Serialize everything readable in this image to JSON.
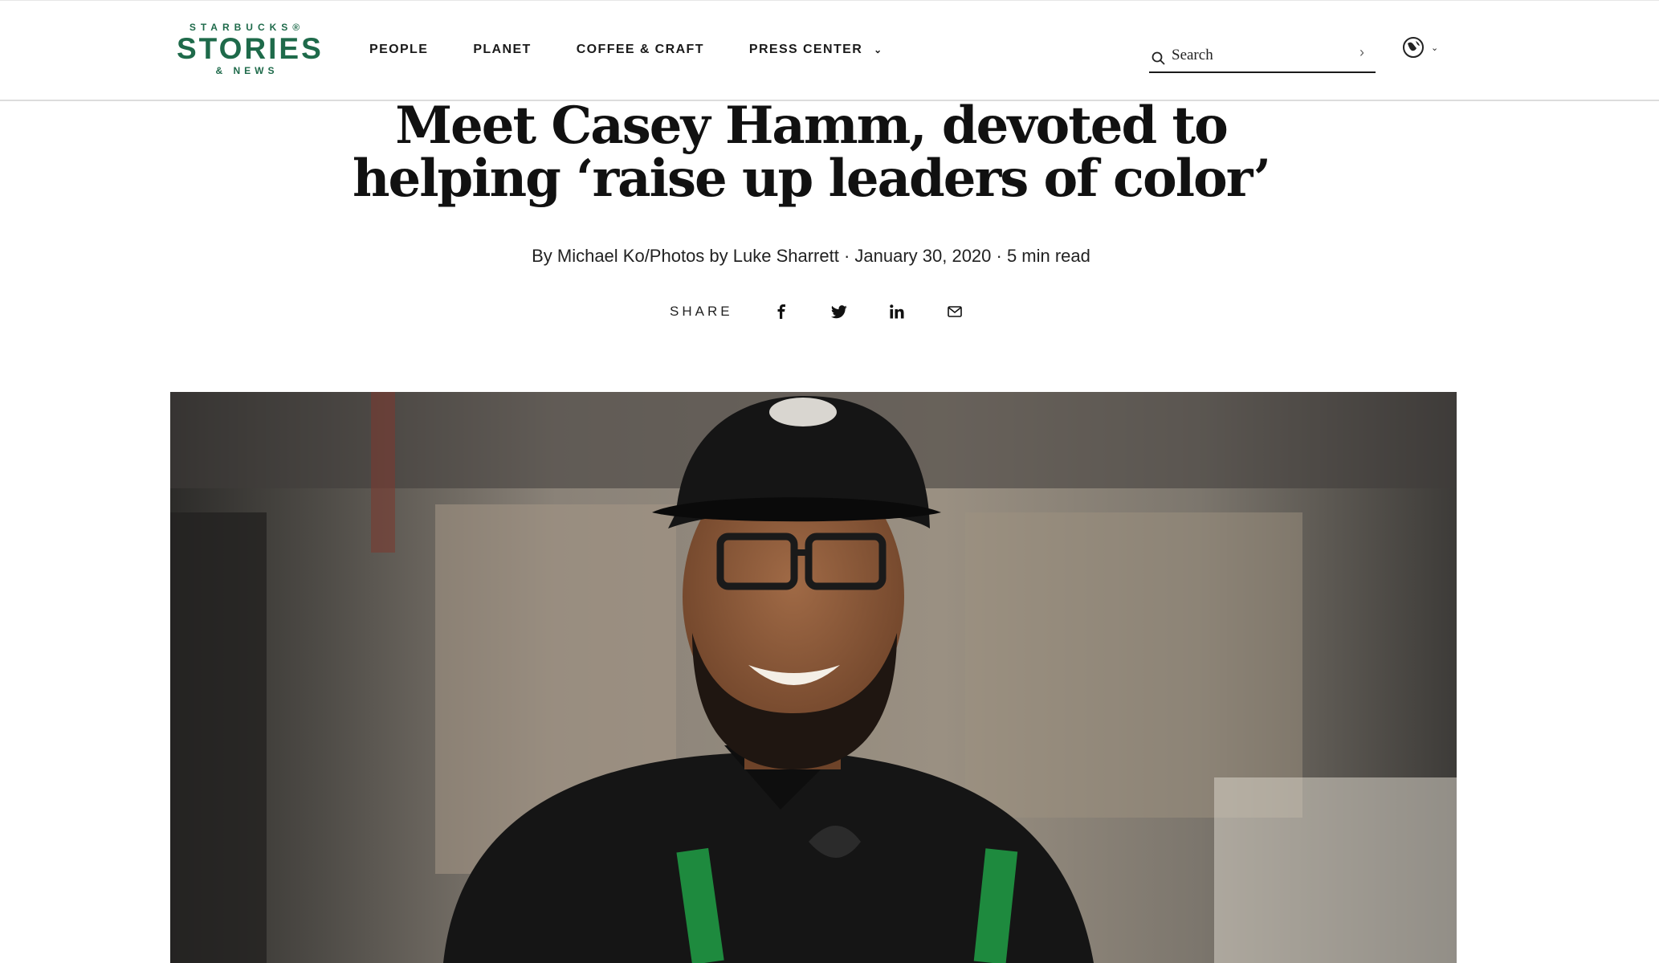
{
  "logo": {
    "line1": "STARBUCKS®",
    "line2": "STORIES",
    "line3": "& NEWS"
  },
  "nav": [
    {
      "label": "PEOPLE"
    },
    {
      "label": "PLANET"
    },
    {
      "label": "COFFEE & CRAFT"
    },
    {
      "label": "PRESS CENTER",
      "has_dropdown": true
    }
  ],
  "search": {
    "placeholder": "Search"
  },
  "article": {
    "title_line1": "Meet Casey Hamm, devoted to",
    "title_line2": "helping ‘raise up leaders of color’",
    "byline": "By Michael Ko/Photos by Luke Sharrett · January 30, 2020 · 5 min read"
  },
  "share": {
    "label": "SHARE",
    "icons": [
      "facebook-icon",
      "twitter-icon",
      "linkedin-icon",
      "email-icon"
    ]
  },
  "colors": {
    "brand_green": "#1e6a4a",
    "apron_green": "#1e8a3e"
  }
}
